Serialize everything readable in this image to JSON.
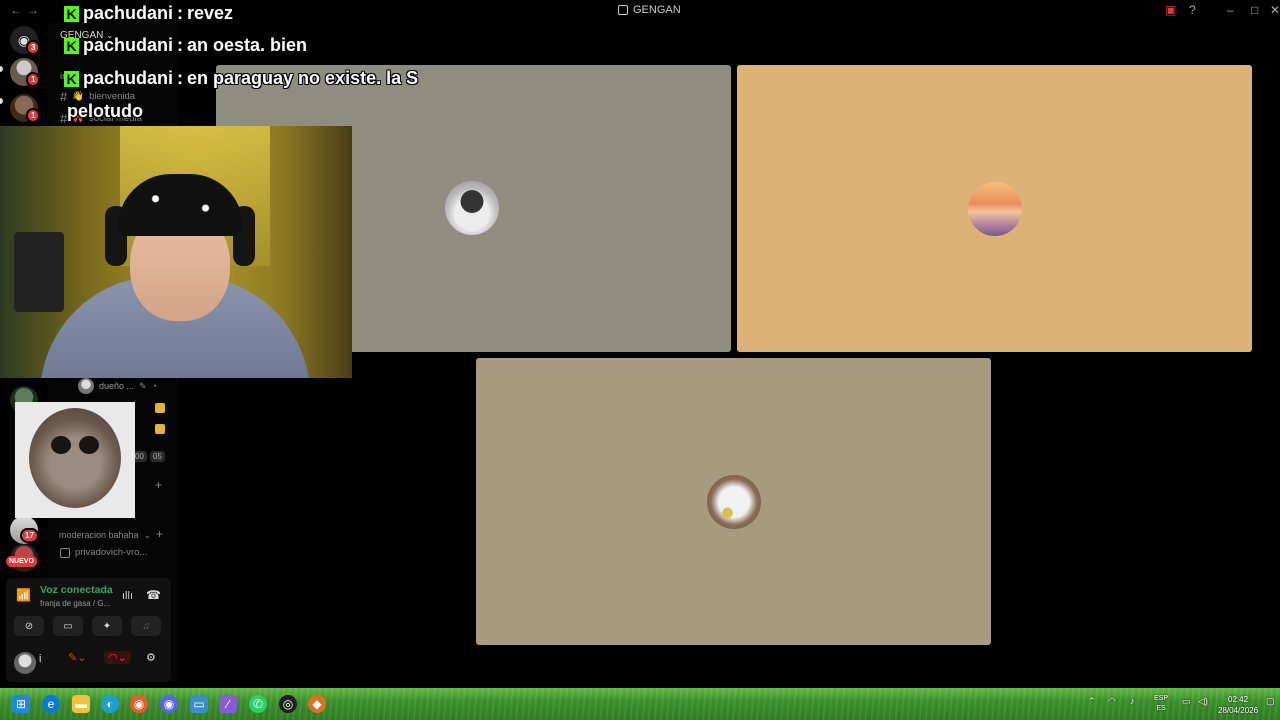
{
  "window": {
    "title": "GENGAN",
    "back_icon": "arrow-left",
    "forward_icon": "arrow-right"
  },
  "servers": {
    "badges": [
      "3",
      "1",
      "1",
      "17"
    ],
    "nuevo_label": "NUEVO"
  },
  "channels": {
    "server_name": "GENGAN",
    "rows": [
      {
        "prefix": "in",
        "label": ""
      },
      {
        "label": "bienvenida",
        "emoji": "👋"
      },
      {
        "label": "social media",
        "emoji": "🎀"
      }
    ],
    "voice_user": "dueño ...",
    "timer_left": "00",
    "timer_right": "05",
    "category": "moderacion bahaha",
    "text_channel": "privadovich-vro..."
  },
  "voice_panel": {
    "status": "Voz conectada",
    "subtitle": "franja de gasa / G...",
    "user_initial": "i"
  },
  "chat_overlay": [
    {
      "user": "pachudani",
      "message": "revez"
    },
    {
      "user": "pachudani",
      "message": "an oesta. bien"
    },
    {
      "user": "pachudani",
      "message": "en paraguay no existe. la S"
    },
    {
      "user": "",
      "message": "pelotudo"
    }
  ],
  "tiles": [
    {
      "name": "tile-1",
      "bg": "#8e8e80"
    },
    {
      "name": "tile-2",
      "bg": "#ddb276"
    },
    {
      "name": "tile-3",
      "bg": "#a89a7e"
    }
  ],
  "taskbar": {
    "lang_top": "ESP",
    "lang_bottom": "ES",
    "time": "02:42",
    "date": "28/04/2026"
  }
}
